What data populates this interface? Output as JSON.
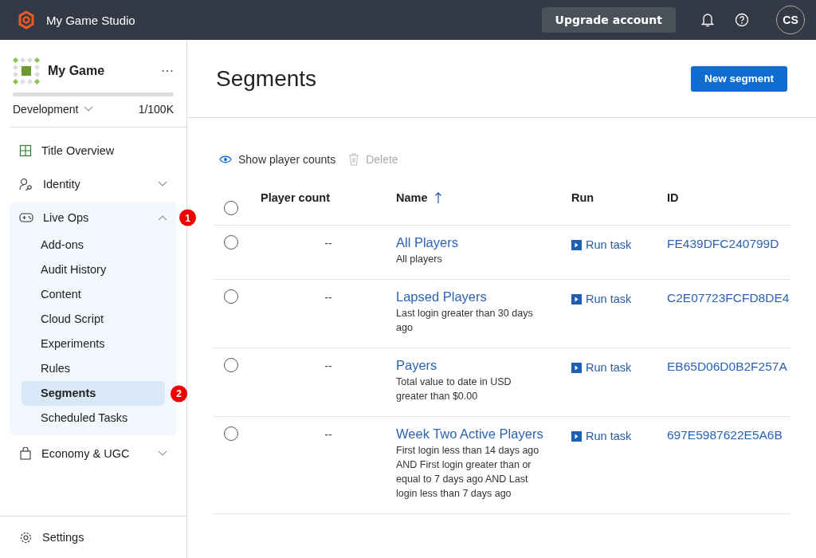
{
  "topbar": {
    "studio": "My Game Studio",
    "upgrade": "Upgrade account",
    "avatar": "CS"
  },
  "game": {
    "name": "My Game",
    "menu": "···",
    "environment": "Development",
    "usage": "1/100K"
  },
  "nav": [
    {
      "label": "Title Overview",
      "kind": "link"
    },
    {
      "label": "Identity",
      "kind": "group",
      "expanded": false
    },
    {
      "label": "Live Ops",
      "kind": "group",
      "expanded": true,
      "badge": "1",
      "children": [
        {
          "label": "Add-ons",
          "selected": false
        },
        {
          "label": "Audit History",
          "selected": false
        },
        {
          "label": "Content",
          "selected": false
        },
        {
          "label": "Cloud Script",
          "selected": false
        },
        {
          "label": "Experiments",
          "selected": false
        },
        {
          "label": "Rules",
          "selected": false
        },
        {
          "label": "Segments",
          "selected": true,
          "badge": "2"
        },
        {
          "label": "Scheduled Tasks",
          "selected": false
        }
      ]
    },
    {
      "label": "Economy & UGC",
      "kind": "group",
      "expanded": false
    }
  ],
  "settings": "Settings",
  "page": {
    "title": "Segments",
    "new_button": "New segment"
  },
  "toolbar": [
    {
      "label": "Show player counts",
      "disabled": false
    },
    {
      "label": "Delete",
      "disabled": true
    }
  ],
  "table": {
    "columns": [
      {
        "label": "Player count",
        "sorted": false
      },
      {
        "label": "Name",
        "sorted": true
      },
      {
        "label": "Run",
        "sorted": false
      },
      {
        "label": "ID",
        "sorted": false
      }
    ],
    "all_selected": false,
    "rows": [
      {
        "selected": false,
        "player_count": "--",
        "name": "All Players",
        "description": "All players",
        "run": "Run task",
        "id": "FE439DFC240799D"
      },
      {
        "selected": false,
        "player_count": "--",
        "name": "Lapsed Players",
        "description": "Last login greater than 30 days ago",
        "run": "Run task",
        "id": "C2E07723FCFD8DE4"
      },
      {
        "selected": false,
        "player_count": "--",
        "name": "Payers",
        "description": "Total value to date in USD greater than $0.00",
        "run": "Run task",
        "id": "EB65D06D0B2F257A"
      },
      {
        "selected": false,
        "player_count": "--",
        "name": "Week Two Active Players",
        "description": "First login less than 14 days ago AND First login greater than or equal to 7 days ago AND Last login less than 7 days ago",
        "run": "Run task",
        "id": "697E5987622E5A6B"
      }
    ]
  }
}
